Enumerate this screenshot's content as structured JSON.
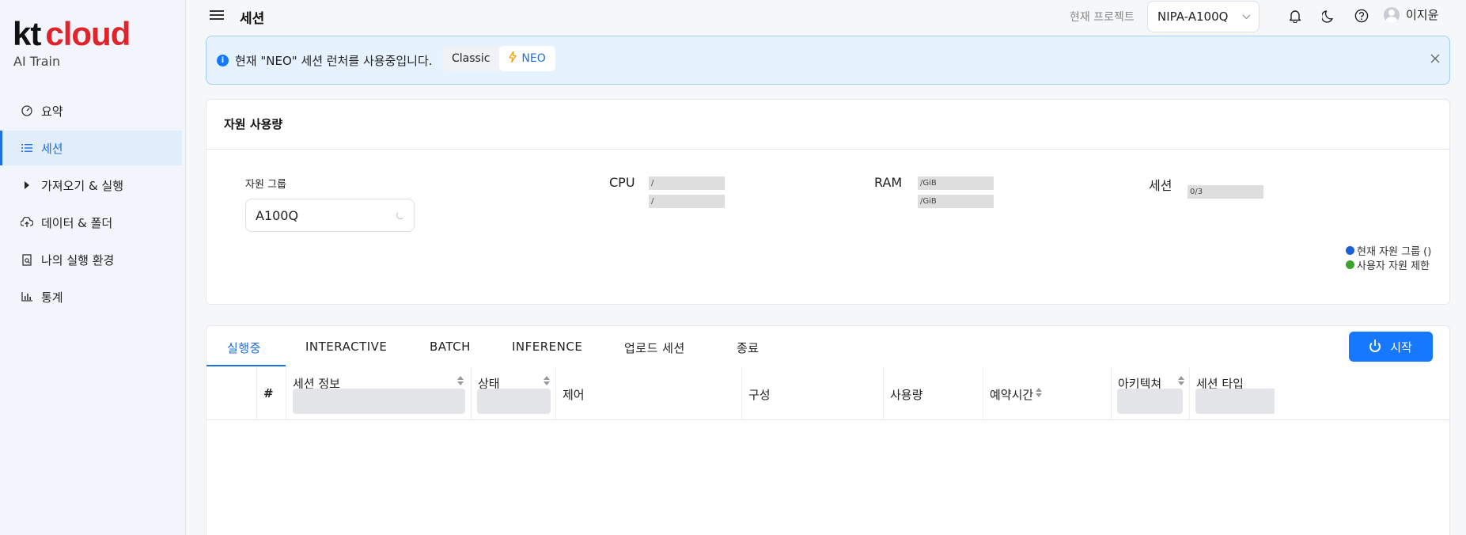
{
  "sidebar": {
    "logo_kt": "kt",
    "logo_cloud": "cloud",
    "subtitle": "AI Train",
    "items": [
      {
        "label": "요약",
        "icon": "dashboard-icon"
      },
      {
        "label": "세션",
        "icon": "list-icon",
        "active": true
      },
      {
        "label": "가져오기 & 실행",
        "icon": "caret-right-icon"
      },
      {
        "label": "데이터 & 폴더",
        "icon": "cloud-upload-icon"
      },
      {
        "label": "나의 실행 환경",
        "icon": "file-search-icon"
      },
      {
        "label": "통계",
        "icon": "bar-chart-icon"
      }
    ]
  },
  "header": {
    "title": "세션",
    "project_label": "현재 프로젝트",
    "project_value": "NIPA-A100Q",
    "user_name": "이지윤",
    "icons": [
      "bell-icon",
      "moon-icon",
      "help-icon",
      "avatar"
    ]
  },
  "alert": {
    "message": "현재 \"NEO\" 세션 런처를 사용중입니다.",
    "options": [
      "Classic",
      "NEO"
    ],
    "selected": "NEO"
  },
  "resource": {
    "title": "자원 사용량",
    "group_label": "자원 그룹",
    "group_value": "A100Q",
    "cpu_label": "CPU",
    "cpu_used": "/",
    "cpu_limit": "/",
    "ram_label": "RAM",
    "ram_used": "/GiB",
    "ram_limit": "/GiB",
    "session_label": "세션",
    "session_value": "0/3",
    "legend_current": "현재 자원 그룹 ()",
    "legend_user": "사용자 자원 제한",
    "legend_current_color": "#1a5fd6",
    "legend_user_color": "#3aa52a"
  },
  "sessions": {
    "tabs": [
      "실행중",
      "INTERACTIVE",
      "BATCH",
      "INFERENCE",
      "업로드 세션",
      "종료"
    ],
    "active_tab": "실행중",
    "start_label": "시작",
    "columns": {
      "index": "#",
      "info": "세션 정보",
      "status": "상태",
      "control": "제어",
      "config": "구성",
      "usage": "사용량",
      "reserve": "예약시간",
      "arch": "아키텍쳐",
      "type": "세션 타입"
    }
  },
  "colors": {
    "accent": "#1677ff",
    "brand_red": "#e0242c"
  }
}
